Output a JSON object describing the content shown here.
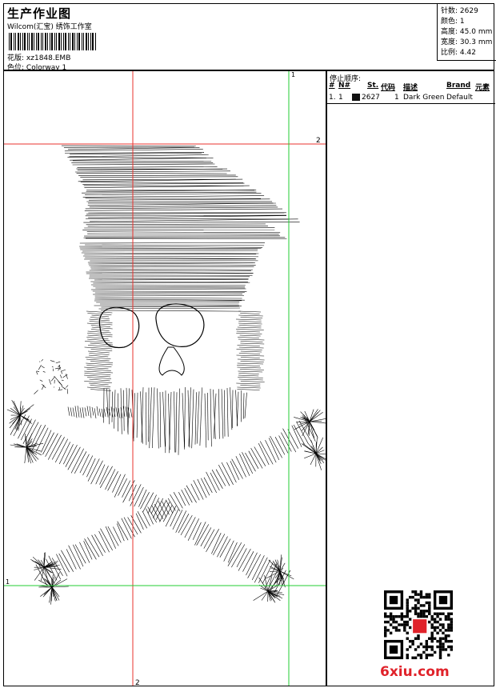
{
  "header": {
    "title": "生产作业图",
    "company": "Wilcom(汇宝) 绣饰工作室",
    "design_file_label": "花版:",
    "design_file": "xz1848.EMB",
    "colorway_label": "色位:",
    "colorway": "Colorway 1"
  },
  "stats": [
    {
      "label": "针数:",
      "value": "2629"
    },
    {
      "label": "颜色:",
      "value": "1"
    },
    {
      "label": "高度:",
      "value": "45.0 mm"
    },
    {
      "label": "宽度:",
      "value": "30.3 mm"
    },
    {
      "label": "比例:",
      "value": "4.42"
    }
  ],
  "guides": {
    "top_red_label": "2",
    "bottom_red_label": "2",
    "top_green_label": "1",
    "left_green_label": "1",
    "red_color": "#e8332e",
    "green_color": "#22cc33"
  },
  "stop_sequence": {
    "title": "停止顺序:",
    "headers": [
      "#",
      "N#",
      "St.",
      "代码",
      "描述",
      "Brand",
      "元素"
    ],
    "rows": [
      {
        "idx": "1.",
        "n": "1",
        "swatch_color": "#111111",
        "stitches": "2627",
        "code": "1",
        "description": "Dark Green",
        "brand": "Default",
        "element": ""
      }
    ]
  },
  "watermark": {
    "text": "6xiu.com",
    "color": "#e0222a",
    "qr_icon": "qr-code-icon"
  }
}
